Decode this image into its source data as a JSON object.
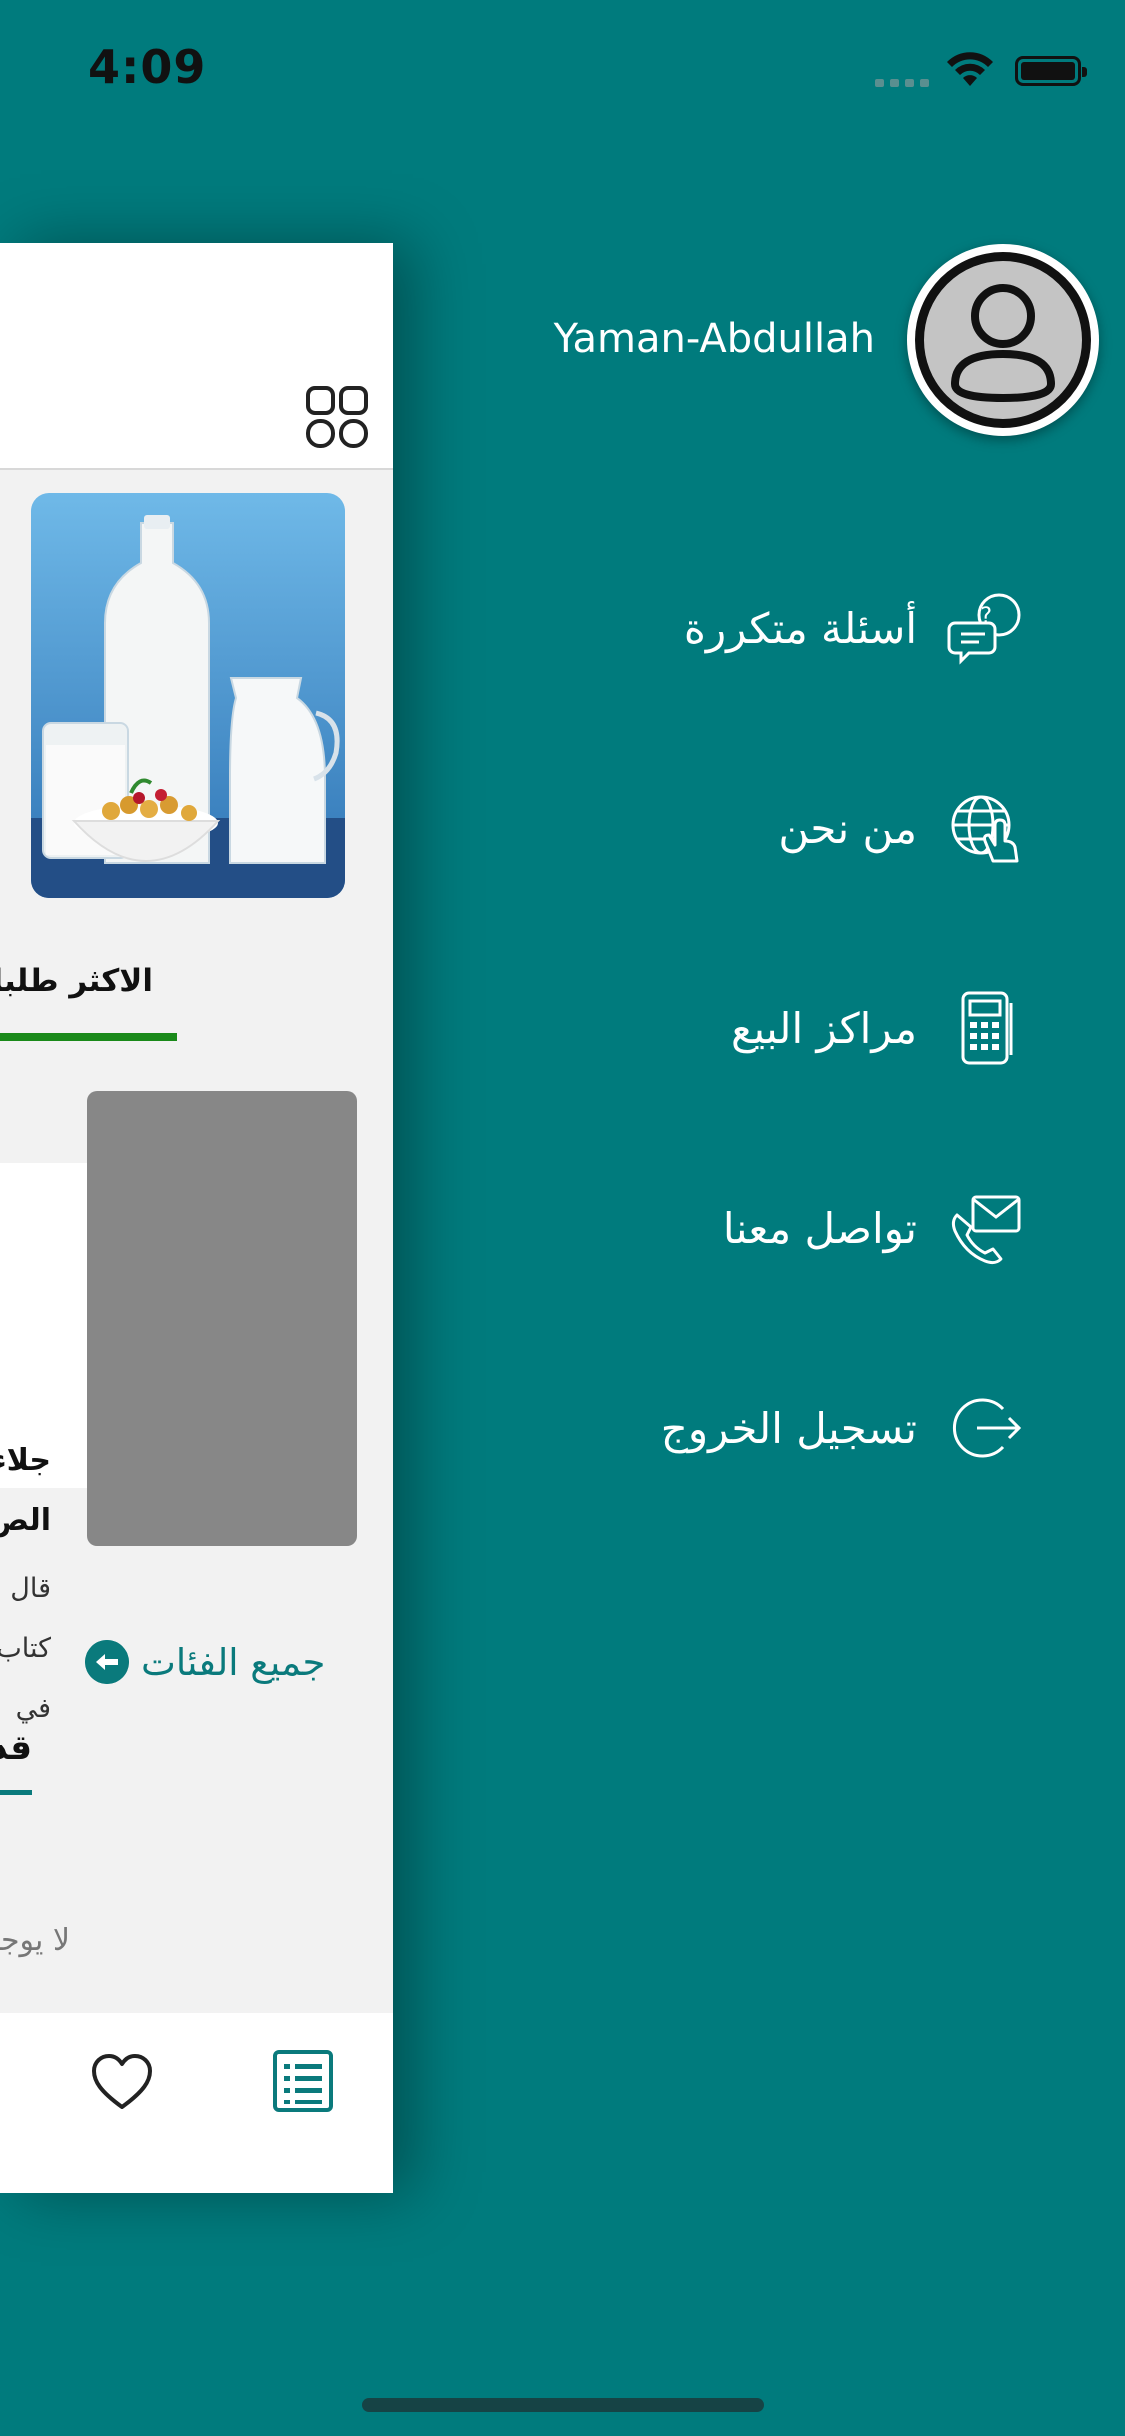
{
  "status_bar": {
    "time": "4:09"
  },
  "drawer": {
    "username": "Yaman-Abdullah",
    "items": [
      {
        "label": "أسئلة متكررة",
        "icon": "faq-chat-icon"
      },
      {
        "label": "من نحن",
        "icon": "globe-hand-icon"
      },
      {
        "label": "مراكز البيع",
        "icon": "pos-terminal-icon"
      },
      {
        "label": "تواصل معنا",
        "icon": "phone-envelope-icon"
      },
      {
        "label": "تسجيل الخروج",
        "icon": "logout-icon"
      }
    ]
  },
  "background_app": {
    "section_title": "الاكثر طلبا",
    "card": {
      "title_line1": "جلاء",
      "title_line2": "الص",
      "body_line1": "قال",
      "body_line2": "كتاب",
      "body_line3": "في"
    },
    "all_categories_label": "جميع الفئات",
    "categories_title": "قد",
    "empty_text": "لا يوجد"
  },
  "colors": {
    "background": "#007B7D",
    "accent_teal": "#0A7A7C",
    "section_underline": "#1A8A1A"
  }
}
